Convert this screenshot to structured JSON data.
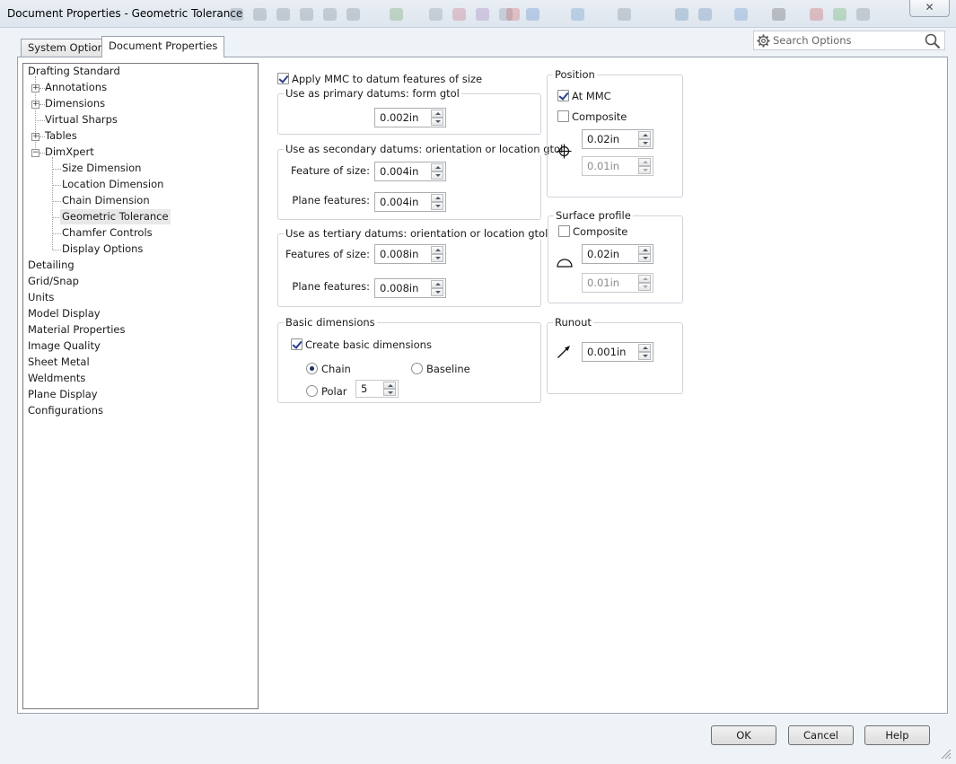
{
  "window": {
    "title": "Document Properties - Geometric Tolerance",
    "close_label": "✕"
  },
  "tabs": [
    {
      "label": "System Options",
      "active": false
    },
    {
      "label": "Document Properties",
      "active": true
    }
  ],
  "search": {
    "placeholder": "Search Options"
  },
  "tree": {
    "items": [
      {
        "label": "Drafting Standard"
      },
      {
        "label": "Annotations",
        "expander": "+"
      },
      {
        "label": "Dimensions",
        "expander": "+"
      },
      {
        "label": "Virtual Sharps"
      },
      {
        "label": "Tables",
        "expander": "+"
      },
      {
        "label": "DimXpert",
        "expander": "-"
      },
      {
        "label": "Size Dimension"
      },
      {
        "label": "Location Dimension"
      },
      {
        "label": "Chain Dimension"
      },
      {
        "label": "Geometric Tolerance",
        "selected": true
      },
      {
        "label": "Chamfer Controls"
      },
      {
        "label": "Display Options"
      },
      {
        "label": "Detailing"
      },
      {
        "label": "Grid/Snap"
      },
      {
        "label": "Units"
      },
      {
        "label": "Model Display"
      },
      {
        "label": "Material Properties"
      },
      {
        "label": "Image Quality"
      },
      {
        "label": "Sheet Metal"
      },
      {
        "label": "Weldments"
      },
      {
        "label": "Plane Display"
      },
      {
        "label": "Configurations"
      }
    ]
  },
  "apply_mmc": {
    "label": "Apply MMC to datum features of size",
    "checked": true
  },
  "primary": {
    "legend": "Use as primary datums: form gtol",
    "value": "0.002in"
  },
  "secondary": {
    "legend": "Use as secondary datums: orientation or location gtol",
    "feature_label": "Feature of size:",
    "feature_value": "0.004in",
    "plane_label": "Plane features:",
    "plane_value": "0.004in"
  },
  "tertiary": {
    "legend": "Use as tertiary datums: orientation or location gtol",
    "feature_label": "Features of size:",
    "feature_value": "0.008in",
    "plane_label": "Plane features:",
    "plane_value": "0.008in"
  },
  "basic": {
    "legend": "Basic dimensions",
    "create_label": "Create basic dimensions",
    "create_checked": true,
    "chain_label": "Chain",
    "chain_selected": true,
    "baseline_label": "Baseline",
    "polar_label": "Polar",
    "polar_value": "5"
  },
  "position": {
    "legend": "Position",
    "at_mmc_label": "At MMC",
    "at_mmc_checked": true,
    "composite_label": "Composite",
    "composite_checked": false,
    "value1": "0.02in",
    "value2": "0.01in",
    "icon": "position-icon"
  },
  "surface_profile": {
    "legend": "Surface profile",
    "composite_label": "Composite",
    "composite_checked": false,
    "value1": "0.02in",
    "value2": "0.01in",
    "icon": "surface-profile-icon"
  },
  "runout": {
    "legend": "Runout",
    "value": "0.001in",
    "icon": "runout-arrow-icon"
  },
  "buttons": {
    "ok": "OK",
    "cancel": "Cancel",
    "help": "Help"
  }
}
